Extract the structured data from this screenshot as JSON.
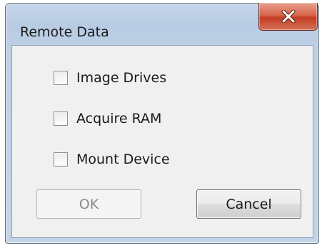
{
  "window": {
    "title": "Remote Data"
  },
  "titlebar": {
    "close_icon": "close-x-icon"
  },
  "options": [
    {
      "label": "Image Drives",
      "checked": false
    },
    {
      "label": "Acquire RAM",
      "checked": false
    },
    {
      "label": "Mount Device",
      "checked": false
    }
  ],
  "buttons": {
    "ok_label": "OK",
    "ok_enabled": false,
    "cancel_label": "Cancel"
  },
  "colors": {
    "close_button": "#c94a2f",
    "frame": "#bdd0e6",
    "client": "#f0f0f0"
  }
}
